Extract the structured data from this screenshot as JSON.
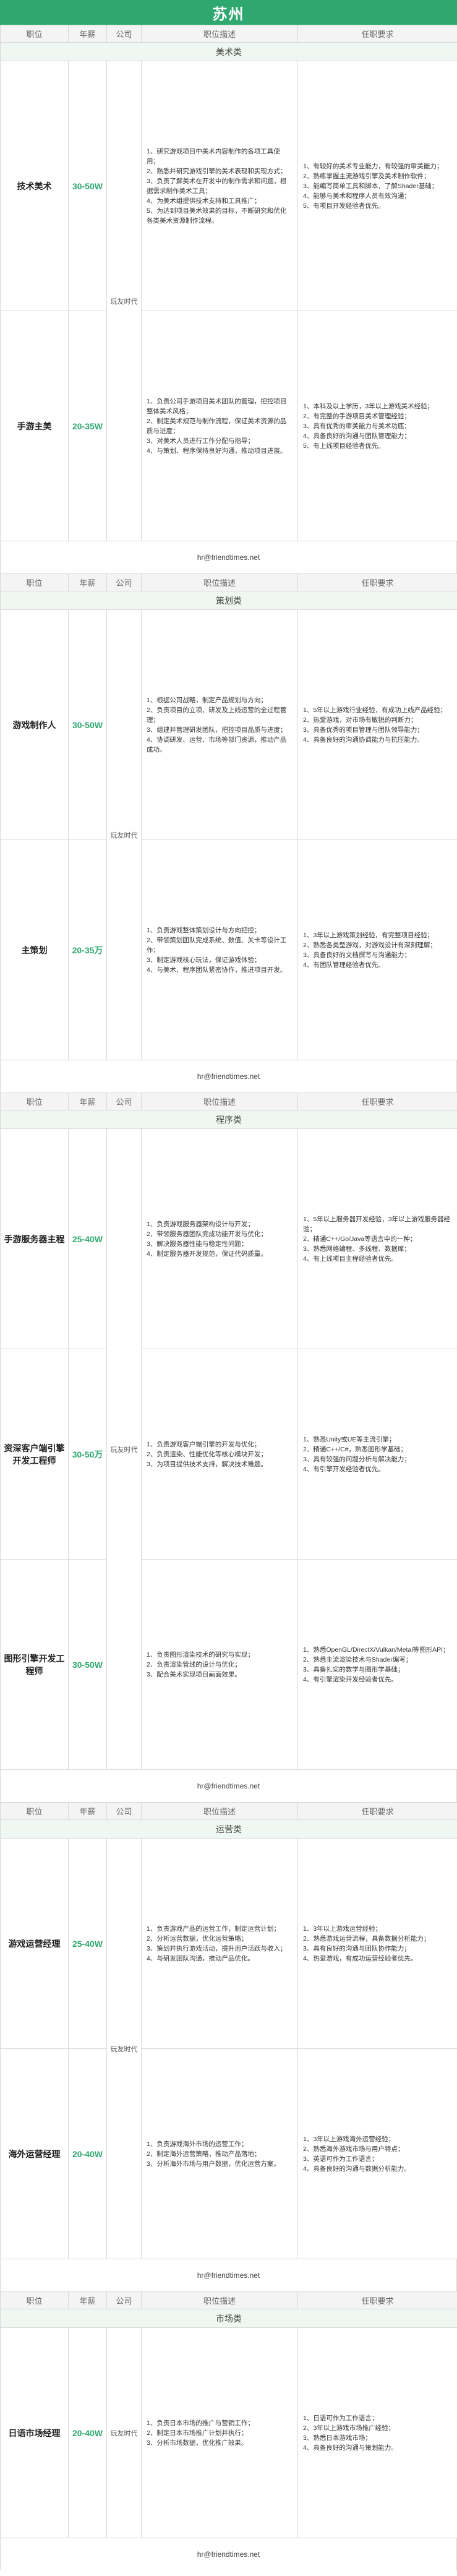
{
  "page_title": "苏州",
  "columns": [
    "职位",
    "年薪",
    "公司",
    "职位描述",
    "任职要求"
  ],
  "company_name": "玩友时代",
  "email": "hr@friendtimes.net",
  "sections": [
    {
      "name": "美术类",
      "jobs": [
        {
          "role": "技术美术",
          "salary": "30-50W",
          "desc": [
            "1、研究游戏项目中美术内容制作的各项工具使用；",
            "2、熟悉并研究游戏引擎的美术表现和实现方式；",
            "3、负责了解美术在开发中的制作需求和问题，根据需求制作美术工具；",
            "4、为美术组提供技术支持和工具推广；",
            "5、为达到项目美术效果的目标，不断研究和优化各类美术资源制作流程。"
          ],
          "req": [
            "1、有较好的美术专业能力，有较强的审美能力；",
            "2、熟练掌握主流游戏引擎及美术制作软件；",
            "3、能编写简单工具和脚本，了解Shader基础；",
            "4、能够与美术和程序人员有效沟通；",
            "5、有项目开发经验者优先。"
          ]
        },
        {
          "role": "手游主美",
          "salary": "20-35W",
          "desc": [
            "1、负责公司手游项目美术团队的管理，把控项目整体美术风格；",
            "2、制定美术规范与制作流程，保证美术资源的品质与进度；",
            "3、对美术人员进行工作分配与指导；",
            "4、与策划、程序保持良好沟通，推动项目进展。"
          ],
          "req": [
            "1、本科及以上学历，3年以上游戏美术经验；",
            "2、有完整的手游项目美术管理经验；",
            "3、具有优秀的审美能力与美术功底；",
            "4、具备良好的沟通与团队管理能力；",
            "5、有上线项目经验者优先。"
          ]
        }
      ]
    },
    {
      "name": "策划类",
      "jobs": [
        {
          "role": "游戏制作人",
          "salary": "30-50W",
          "desc": [
            "1、根据公司战略，制定产品规划与方向；",
            "2、负责项目的立项、研发及上线运营的全过程管理；",
            "3、组建并管理研发团队，把控项目品质与进度；",
            "4、协调研发、运营、市场等部门资源，推动产品成功。"
          ],
          "req": [
            "1、5年以上游戏行业经验，有成功上线产品经验；",
            "2、热爱游戏，对市场有敏锐的判断力；",
            "3、具备优秀的项目管理与团队领导能力；",
            "4、具备良好的沟通协调能力与抗压能力。"
          ]
        },
        {
          "role": "主策划",
          "salary": "20-35万",
          "desc": [
            "1、负责游戏整体策划设计与方向把控；",
            "2、带领策划团队完成系统、数值、关卡等设计工作；",
            "3、制定游戏核心玩法，保证游戏体验；",
            "4、与美术、程序团队紧密协作，推进项目开发。"
          ],
          "req": [
            "1、3年以上游戏策划经验，有完整项目经验；",
            "2、熟悉各类型游戏，对游戏设计有深刻理解；",
            "3、具备良好的文档撰写与沟通能力；",
            "4、有团队管理经验者优先。"
          ]
        }
      ]
    },
    {
      "name": "程序类",
      "jobs": [
        {
          "role": "手游服务器主程",
          "salary": "25-40W",
          "desc": [
            "1、负责游戏服务器架构设计与开发；",
            "2、带领服务器团队完成功能开发与优化；",
            "3、解决服务器性能与稳定性问题；",
            "4、制定服务器开发规范，保证代码质量。"
          ],
          "req": [
            "1、5年以上服务器开发经验，3年以上游戏服务器经验；",
            "2、精通C++/Go/Java等语言中的一种；",
            "3、熟悉网络编程、多线程、数据库；",
            "4、有上线项目主程经验者优先。"
          ]
        },
        {
          "role": "资深客户端引擎开发工程师",
          "salary": "30-50万",
          "desc": [
            "1、负责游戏客户端引擎的开发与优化；",
            "2、负责渲染、性能优化等核心模块开发；",
            "3、为项目提供技术支持，解决技术难题。"
          ],
          "req": [
            "1、熟悉Unity或UE等主流引擎；",
            "2、精通C++/C#，熟悉图形学基础；",
            "3、具有较强的问题分析与解决能力；",
            "4、有引擎开发经验者优先。"
          ]
        },
        {
          "role": "图形引擎开发工程师",
          "salary": "30-50W",
          "desc": [
            "1、负责图形渲染技术的研究与实现；",
            "2、负责渲染管线的设计与优化；",
            "3、配合美术实现项目画面效果。"
          ],
          "req": [
            "1、熟悉OpenGL/DirectX/Vulkan/Metal等图形API；",
            "2、熟悉主流渲染技术与Shader编写；",
            "3、具备扎实的数学与图形学基础；",
            "4、有引擎渲染开发经验者优先。"
          ]
        }
      ]
    },
    {
      "name": "运营类",
      "jobs": [
        {
          "role": "游戏运营经理",
          "salary": "25-40W",
          "desc": [
            "1、负责游戏产品的运营工作，制定运营计划；",
            "2、分析运营数据，优化运营策略；",
            "3、策划并执行游戏活动，提升用户活跃与收入；",
            "4、与研发团队沟通，推动产品优化。"
          ],
          "req": [
            "1、3年以上游戏运营经验；",
            "2、熟悉游戏运营流程，具备数据分析能力；",
            "3、具有良好的沟通与团队协作能力；",
            "4、热爱游戏，有成功运营经验者优先。"
          ]
        },
        {
          "role": "海外运营经理",
          "salary": "20-40W",
          "desc": [
            "1、负责游戏海外市场的运营工作；",
            "2、制定海外运营策略，推动产品落地；",
            "3、分析海外市场与用户数据，优化运营方案。"
          ],
          "req": [
            "1、3年以上游戏海外运营经验；",
            "2、熟悉海外游戏市场与用户特点；",
            "3、英语可作为工作语言；",
            "4、具备良好的沟通与数据分析能力。"
          ]
        }
      ]
    },
    {
      "name": "市场类",
      "jobs": [
        {
          "role": "日语市场经理",
          "salary": "20-40W",
          "desc": [
            "1、负责日本市场的推广与营销工作；",
            "2、制定日本市场推广计划并执行；",
            "3、分析市场数据，优化推广效果。"
          ],
          "req": [
            "1、日语可作为工作语言；",
            "2、3年以上游戏市场推广经验；",
            "3、熟悉日本游戏市场；",
            "4、具备良好的沟通与策划能力。"
          ]
        }
      ]
    }
  ]
}
